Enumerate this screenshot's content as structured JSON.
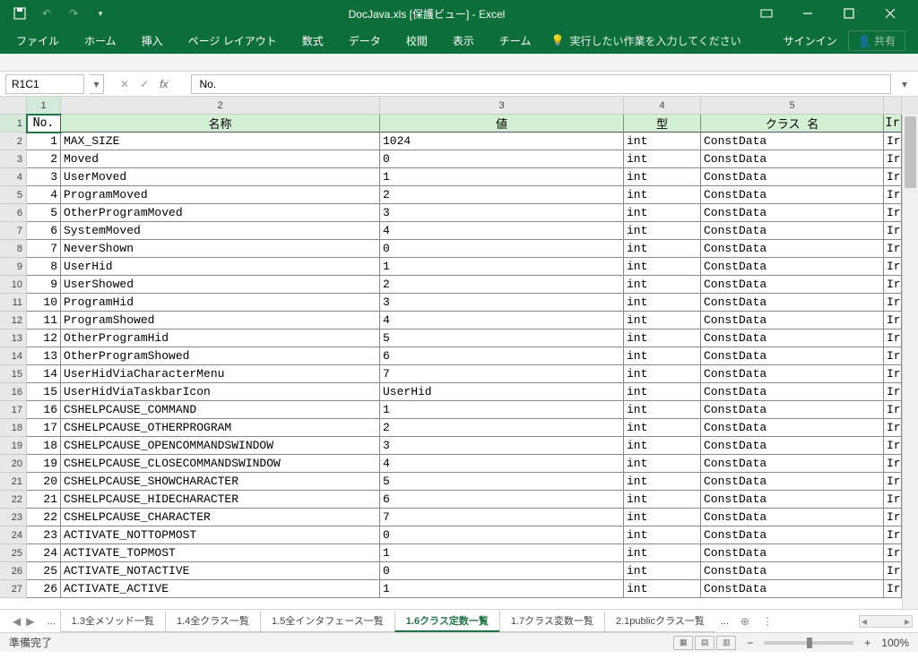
{
  "title": "DocJava.xls  [保護ビュー] - Excel",
  "qat": {
    "save": "save",
    "undo": "↶",
    "redo": "↷",
    "more": "▾"
  },
  "ribbon": {
    "tabs": [
      "ファイル",
      "ホーム",
      "挿入",
      "ページ レイアウト",
      "数式",
      "データ",
      "校閲",
      "表示",
      "チーム"
    ],
    "tellme_icon": "lightbulb",
    "tellme": "実行したい作業を入力してください",
    "signin": "サインイン",
    "share_icon": "person",
    "share": "共有"
  },
  "namebox": "R1C1",
  "fx_label": "fx",
  "formula": "No.",
  "colnums": [
    "1",
    "2",
    "3",
    "4",
    "5",
    ""
  ],
  "headers": {
    "c1": "No.",
    "c2": "名称",
    "c3": "値",
    "c4": "型",
    "c5": "クラス 名",
    "c6": "Ir"
  },
  "rows": [
    {
      "n": "1",
      "name": "MAX_SIZE",
      "val": "1024",
      "type": "int",
      "cls": "ConstData",
      "x": "Ir"
    },
    {
      "n": "2",
      "name": "Moved",
      "val": "0",
      "type": "int",
      "cls": "ConstData",
      "x": "Ir"
    },
    {
      "n": "3",
      "name": "UserMoved",
      "val": "1",
      "type": "int",
      "cls": "ConstData",
      "x": "Ir"
    },
    {
      "n": "4",
      "name": "ProgramMoved",
      "val": "2",
      "type": "int",
      "cls": "ConstData",
      "x": "Ir"
    },
    {
      "n": "5",
      "name": "OtherProgramMoved",
      "val": "3",
      "type": "int",
      "cls": "ConstData",
      "x": "Ir"
    },
    {
      "n": "6",
      "name": "SystemMoved",
      "val": "4",
      "type": "int",
      "cls": "ConstData",
      "x": "Ir"
    },
    {
      "n": "7",
      "name": "NeverShown",
      "val": "0",
      "type": "int",
      "cls": "ConstData",
      "x": "Ir"
    },
    {
      "n": "8",
      "name": "UserHid",
      "val": "1",
      "type": "int",
      "cls": "ConstData",
      "x": "Ir"
    },
    {
      "n": "9",
      "name": "UserShowed",
      "val": "2",
      "type": "int",
      "cls": "ConstData",
      "x": "Ir"
    },
    {
      "n": "10",
      "name": "ProgramHid",
      "val": "3",
      "type": "int",
      "cls": "ConstData",
      "x": "Ir"
    },
    {
      "n": "11",
      "name": "ProgramShowed",
      "val": "4",
      "type": "int",
      "cls": "ConstData",
      "x": "Ir"
    },
    {
      "n": "12",
      "name": "OtherProgramHid",
      "val": "5",
      "type": "int",
      "cls": "ConstData",
      "x": "Ir"
    },
    {
      "n": "13",
      "name": "OtherProgramShowed",
      "val": "6",
      "type": "int",
      "cls": "ConstData",
      "x": "Ir"
    },
    {
      "n": "14",
      "name": "UserHidViaCharacterMenu",
      "val": "7",
      "type": "int",
      "cls": "ConstData",
      "x": "Ir"
    },
    {
      "n": "15",
      "name": "UserHidViaTaskbarIcon",
      "val": "UserHid",
      "type": "int",
      "cls": "ConstData",
      "x": "Ir"
    },
    {
      "n": "16",
      "name": "CSHELPCAUSE_COMMAND",
      "val": "1",
      "type": "int",
      "cls": "ConstData",
      "x": "Ir"
    },
    {
      "n": "17",
      "name": "CSHELPCAUSE_OTHERPROGRAM",
      "val": "2",
      "type": "int",
      "cls": "ConstData",
      "x": "Ir"
    },
    {
      "n": "18",
      "name": "CSHELPCAUSE_OPENCOMMANDSWINDOW",
      "val": "3",
      "type": "int",
      "cls": "ConstData",
      "x": "Ir"
    },
    {
      "n": "19",
      "name": "CSHELPCAUSE_CLOSECOMMANDSWINDOW",
      "val": "4",
      "type": "int",
      "cls": "ConstData",
      "x": "Ir"
    },
    {
      "n": "20",
      "name": "CSHELPCAUSE_SHOWCHARACTER",
      "val": "5",
      "type": "int",
      "cls": "ConstData",
      "x": "Ir"
    },
    {
      "n": "21",
      "name": "CSHELPCAUSE_HIDECHARACTER",
      "val": "6",
      "type": "int",
      "cls": "ConstData",
      "x": "Ir"
    },
    {
      "n": "22",
      "name": "CSHELPCAUSE_CHARACTER",
      "val": "7",
      "type": "int",
      "cls": "ConstData",
      "x": "Ir"
    },
    {
      "n": "23",
      "name": "ACTIVATE_NOTTOPMOST",
      "val": "0",
      "type": "int",
      "cls": "ConstData",
      "x": "Ir"
    },
    {
      "n": "24",
      "name": "ACTIVATE_TOPMOST",
      "val": "1",
      "type": "int",
      "cls": "ConstData",
      "x": "Ir"
    },
    {
      "n": "25",
      "name": "ACTIVATE_NOTACTIVE",
      "val": "0",
      "type": "int",
      "cls": "ConstData",
      "x": "Ir"
    },
    {
      "n": "26",
      "name": "ACTIVATE_ACTIVE",
      "val": "1",
      "type": "int",
      "cls": "ConstData",
      "x": "Ir"
    }
  ],
  "sheets": {
    "dots": "...",
    "tabs": [
      "1.3全メソッド一覧",
      "1.4全クラス一覧",
      "1.5全インタフェース一覧",
      "1.6クラス定数一覧",
      "1.7クラス変数一覧",
      "2.1publicクラス一覧"
    ],
    "active_index": 3,
    "add": "⊕",
    "more": "..."
  },
  "status": {
    "ready": "準備完了",
    "zoom": "100%",
    "minus": "−",
    "plus": "+"
  }
}
